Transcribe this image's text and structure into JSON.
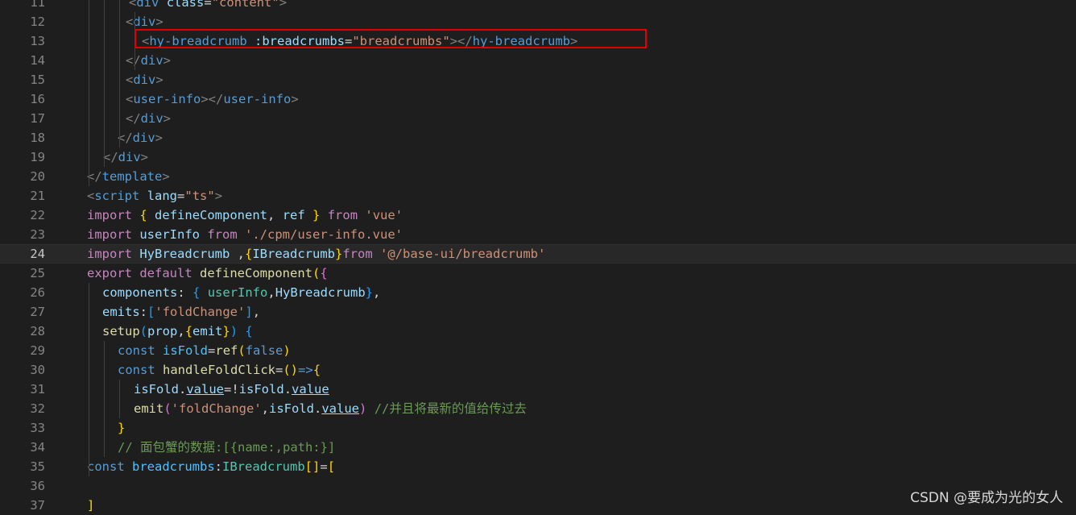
{
  "editor": {
    "highlighted_line": "13",
    "current_line": "24",
    "lines": [
      {
        "num": "11",
        "tokens": [
          [
            "t-tag",
            "<"
          ],
          [
            "t-name",
            "div"
          ],
          [
            "t-plain",
            " "
          ],
          [
            "t-attr",
            "class"
          ],
          [
            "t-plain",
            "="
          ],
          [
            "t-str",
            "\"content\""
          ],
          [
            "t-tag",
            ">"
          ]
        ]
      },
      {
        "num": "12",
        "tokens": [
          [
            "t-tag",
            "<"
          ],
          [
            "t-name",
            "div"
          ],
          [
            "t-tag",
            ">"
          ]
        ]
      },
      {
        "num": "13",
        "tokens": [
          [
            "t-tag",
            "<"
          ],
          [
            "t-name",
            "hy-breadcrumb"
          ],
          [
            "t-plain",
            " "
          ],
          [
            "t-attr",
            ":breadcrumbs"
          ],
          [
            "t-plain",
            "="
          ],
          [
            "t-str",
            "\"breadcrumbs\""
          ],
          [
            "t-tag",
            "></"
          ],
          [
            "t-name",
            "hy-breadcrumb"
          ],
          [
            "t-tag",
            ">"
          ]
        ]
      },
      {
        "num": "14",
        "tokens": [
          [
            "t-tag",
            "</"
          ],
          [
            "t-name",
            "div"
          ],
          [
            "t-tag",
            ">"
          ]
        ]
      },
      {
        "num": "15",
        "tokens": [
          [
            "t-tag",
            "<"
          ],
          [
            "t-name",
            "div"
          ],
          [
            "t-tag",
            ">"
          ]
        ]
      },
      {
        "num": "16",
        "tokens": [
          [
            "t-tag",
            "<"
          ],
          [
            "t-name",
            "user-info"
          ],
          [
            "t-tag",
            "></"
          ],
          [
            "t-name",
            "user-info"
          ],
          [
            "t-tag",
            ">"
          ]
        ]
      },
      {
        "num": "17",
        "tokens": [
          [
            "t-tag",
            "</"
          ],
          [
            "t-name",
            "div"
          ],
          [
            "t-tag",
            ">"
          ]
        ]
      },
      {
        "num": "18",
        "tokens": [
          [
            "t-tag",
            "</"
          ],
          [
            "t-name",
            "div"
          ],
          [
            "t-tag",
            ">"
          ]
        ]
      },
      {
        "num": "19",
        "tokens": [
          [
            "t-tag",
            "</"
          ],
          [
            "t-name",
            "div"
          ],
          [
            "t-tag",
            ">"
          ]
        ]
      },
      {
        "num": "20",
        "tokens": [
          [
            "t-tag",
            "</"
          ],
          [
            "t-name",
            "template"
          ],
          [
            "t-tag",
            ">"
          ]
        ]
      },
      {
        "num": "21",
        "tokens": [
          [
            "t-tag",
            "<"
          ],
          [
            "t-name",
            "script"
          ],
          [
            "t-plain",
            " "
          ],
          [
            "t-attr",
            "lang"
          ],
          [
            "t-plain",
            "="
          ],
          [
            "t-str",
            "\"ts\""
          ],
          [
            "t-tag",
            ">"
          ]
        ]
      },
      {
        "num": "22",
        "tokens": [
          [
            "t-kw",
            "import"
          ],
          [
            "t-plain",
            " "
          ],
          [
            "t-br1",
            "{"
          ],
          [
            "t-plain",
            " "
          ],
          [
            "t-var",
            "defineComponent"
          ],
          [
            "t-plain",
            ", "
          ],
          [
            "t-var",
            "ref"
          ],
          [
            "t-plain",
            " "
          ],
          [
            "t-br1",
            "}"
          ],
          [
            "t-plain",
            " "
          ],
          [
            "t-kw",
            "from"
          ],
          [
            "t-plain",
            " "
          ],
          [
            "t-str",
            "'vue'"
          ]
        ]
      },
      {
        "num": "23",
        "tokens": [
          [
            "t-kw",
            "import"
          ],
          [
            "t-plain",
            " "
          ],
          [
            "t-var",
            "userInfo"
          ],
          [
            "t-plain",
            " "
          ],
          [
            "t-kw",
            "from"
          ],
          [
            "t-plain",
            " "
          ],
          [
            "t-str",
            "'./cpm/user-info.vue'"
          ]
        ]
      },
      {
        "num": "24",
        "tokens": [
          [
            "t-kw",
            "import"
          ],
          [
            "t-plain",
            " "
          ],
          [
            "t-var",
            "HyBreadcrumb"
          ],
          [
            "t-plain",
            " ,"
          ],
          [
            "t-br1",
            "{"
          ],
          [
            "t-var",
            "IBreadcrumb"
          ],
          [
            "t-br1",
            "}"
          ],
          [
            "t-kw",
            "from"
          ],
          [
            "t-plain",
            " "
          ],
          [
            "t-str",
            "'@/base-ui/breadcrumb'"
          ]
        ]
      },
      {
        "num": "25",
        "tokens": [
          [
            "t-kw",
            "export"
          ],
          [
            "t-plain",
            " "
          ],
          [
            "t-kw",
            "default"
          ],
          [
            "t-plain",
            " "
          ],
          [
            "t-fn",
            "defineComponent"
          ],
          [
            "t-br1",
            "("
          ],
          [
            "t-br2",
            "{"
          ]
        ]
      },
      {
        "num": "26",
        "tokens": [
          [
            "t-var",
            "components"
          ],
          [
            "t-plain",
            ": "
          ],
          [
            "t-br3",
            "{"
          ],
          [
            "t-plain",
            " "
          ],
          [
            "t-type",
            "userInfo"
          ],
          [
            "t-plain",
            ","
          ],
          [
            "t-var",
            "HyBreadcrumb"
          ],
          [
            "t-br3",
            "}"
          ],
          [
            "t-plain",
            ","
          ]
        ]
      },
      {
        "num": "27",
        "tokens": [
          [
            "t-var",
            "emits"
          ],
          [
            "t-plain",
            ":"
          ],
          [
            "t-br3",
            "["
          ],
          [
            "t-str",
            "'foldChange'"
          ],
          [
            "t-br3",
            "]"
          ],
          [
            "t-plain",
            ","
          ]
        ]
      },
      {
        "num": "28",
        "tokens": [
          [
            "t-fn",
            "setup"
          ],
          [
            "t-br3",
            "("
          ],
          [
            "t-var",
            "prop"
          ],
          [
            "t-plain",
            ","
          ],
          [
            "t-br1",
            "{"
          ],
          [
            "t-var",
            "emit"
          ],
          [
            "t-br1",
            "}"
          ],
          [
            "t-br3",
            ")"
          ],
          [
            "t-plain",
            " "
          ],
          [
            "t-br3",
            "{"
          ]
        ]
      },
      {
        "num": "29",
        "tokens": [
          [
            "t-bool",
            "const"
          ],
          [
            "t-plain",
            " "
          ],
          [
            "t-cst",
            "isFold"
          ],
          [
            "t-plain",
            "="
          ],
          [
            "t-fn",
            "ref"
          ],
          [
            "t-br1",
            "("
          ],
          [
            "t-bool",
            "false"
          ],
          [
            "t-br1",
            ")"
          ]
        ]
      },
      {
        "num": "30",
        "tokens": [
          [
            "t-bool",
            "const"
          ],
          [
            "t-plain",
            " "
          ],
          [
            "t-fn",
            "handleFoldClick"
          ],
          [
            "t-plain",
            "="
          ],
          [
            "t-br1",
            "()"
          ],
          [
            "t-bool",
            "=>"
          ],
          [
            "t-br1",
            "{"
          ]
        ]
      },
      {
        "num": "31",
        "tokens": [
          [
            "t-var",
            "isFold"
          ],
          [
            "t-plain",
            "."
          ],
          [
            "t-var t-und",
            "value"
          ],
          [
            "t-plain",
            "=!"
          ],
          [
            "t-var",
            "isFold"
          ],
          [
            "t-plain",
            "."
          ],
          [
            "t-var t-und",
            "value"
          ]
        ]
      },
      {
        "num": "32",
        "tokens": [
          [
            "t-fn",
            "emit"
          ],
          [
            "t-br2",
            "("
          ],
          [
            "t-str",
            "'foldChange'"
          ],
          [
            "t-plain",
            ","
          ],
          [
            "t-var",
            "isFold"
          ],
          [
            "t-plain",
            "."
          ],
          [
            "t-var t-und",
            "value"
          ],
          [
            "t-br2",
            ")"
          ],
          [
            "t-plain",
            " "
          ],
          [
            "t-cmt",
            "//并且将最新的值给传过去"
          ]
        ]
      },
      {
        "num": "33",
        "tokens": [
          [
            "t-br1",
            "}"
          ]
        ]
      },
      {
        "num": "34",
        "tokens": [
          [
            "t-cmt",
            "// 面包蟹的数据:[{name:,path:}]"
          ]
        ]
      },
      {
        "num": "35",
        "tokens": [
          [
            "t-bool",
            "const"
          ],
          [
            "t-plain",
            " "
          ],
          [
            "t-cst",
            "breadcrumbs"
          ],
          [
            "t-plain",
            ":"
          ],
          [
            "t-type",
            "IBreadcrumb"
          ],
          [
            "t-br1",
            "[]"
          ],
          [
            "t-plain",
            "="
          ],
          [
            "t-br1",
            "["
          ]
        ]
      },
      {
        "num": "36",
        "tokens": []
      },
      {
        "num": "37",
        "tokens": [
          [
            "t-br1",
            "]"
          ]
        ]
      }
    ]
  },
  "watermark": "CSDN @要成为光的女人"
}
